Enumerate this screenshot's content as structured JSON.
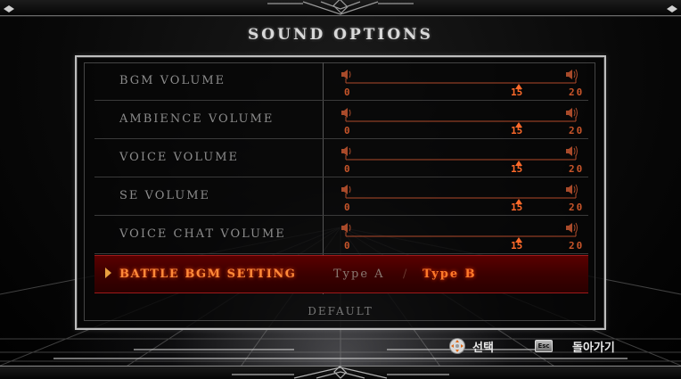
{
  "screen": {
    "title": "SOUND OPTIONS"
  },
  "sliders": [
    {
      "label": "BGM VOLUME",
      "min": "0",
      "max": "20",
      "value": "15"
    },
    {
      "label": "AMBIENCE VOLUME",
      "min": "0",
      "max": "20",
      "value": "15"
    },
    {
      "label": "VOICE VOLUME",
      "min": "0",
      "max": "20",
      "value": "15"
    },
    {
      "label": "SE VOLUME",
      "min": "0",
      "max": "20",
      "value": "15"
    },
    {
      "label": "VOICE CHAT VOLUME",
      "min": "0",
      "max": "20",
      "value": "15"
    }
  ],
  "battle_bgm": {
    "label": "BATTLE BGM SETTING",
    "option_a": "Type A",
    "separator": "/",
    "option_b": "Type B",
    "selected": "Type B"
  },
  "default_label": "DEFAULT",
  "hints": {
    "select_label": "선택",
    "back_key": "Esc",
    "back_label": "돌아가기"
  },
  "icons": {
    "speaker": "speaker-icon",
    "cursor": "selection-arrow-icon",
    "dpad": "dpad-icon"
  },
  "colors": {
    "accent": "#ff6a2a",
    "selected_row": "#4a0000",
    "label_dim": "#8c8c8c"
  }
}
